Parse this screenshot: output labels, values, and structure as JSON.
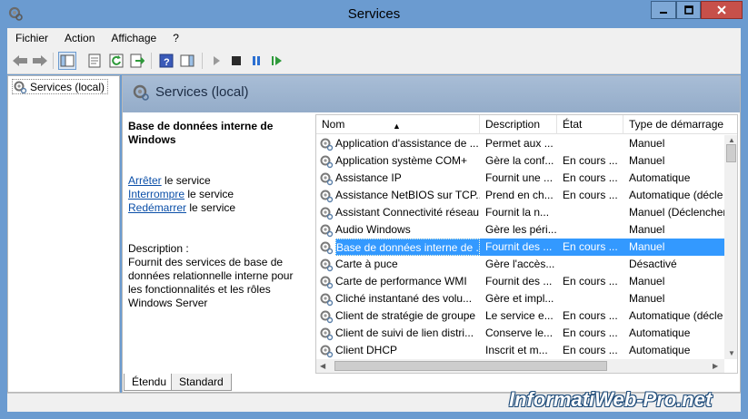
{
  "window": {
    "title": "Services"
  },
  "menu": [
    "Fichier",
    "Action",
    "Affichage",
    "?"
  ],
  "tree": {
    "root_label": "Services (local)"
  },
  "main": {
    "header_title": "Services (local)",
    "selected_service_title": "Base de données interne de Windows",
    "actions": [
      {
        "link": "Arrêter",
        "suffix": " le service"
      },
      {
        "link": "Interrompre",
        "suffix": " le service"
      },
      {
        "link": "Redémarrer",
        "suffix": " le service"
      }
    ],
    "description_label": "Description :",
    "description_text": "Fournit des services de base de données relationnelle interne pour les fonctionnalités et les rôles Windows Server"
  },
  "list": {
    "columns": [
      "Nom",
      "Description",
      "État",
      "Type de démarrage"
    ],
    "rows": [
      {
        "name": "Application d'assistance de ...",
        "desc": "Permet aux ...",
        "state": "",
        "startup": "Manuel"
      },
      {
        "name": "Application système COM+",
        "desc": "Gère la conf...",
        "state": "En cours ...",
        "startup": "Manuel"
      },
      {
        "name": "Assistance IP",
        "desc": "Fournit une ...",
        "state": "En cours ...",
        "startup": "Automatique"
      },
      {
        "name": "Assistance NetBIOS sur TCP...",
        "desc": "Prend en ch...",
        "state": "En cours ...",
        "startup": "Automatique (décle"
      },
      {
        "name": "Assistant Connectivité réseau",
        "desc": "Fournit la n...",
        "state": "",
        "startup": "Manuel (Déclencher"
      },
      {
        "name": "Audio Windows",
        "desc": "Gère les péri...",
        "state": "",
        "startup": "Manuel"
      },
      {
        "name": "Base de données interne de ...",
        "desc": "Fournit des ...",
        "state": "En cours ...",
        "startup": "Manuel",
        "selected": true
      },
      {
        "name": "Carte à puce",
        "desc": "Gère l'accès...",
        "state": "",
        "startup": "Désactivé"
      },
      {
        "name": "Carte de performance WMI",
        "desc": "Fournit des ...",
        "state": "En cours ...",
        "startup": "Manuel"
      },
      {
        "name": "Cliché instantané des volu...",
        "desc": "Gère et impl...",
        "state": "",
        "startup": "Manuel"
      },
      {
        "name": "Client de stratégie de groupe",
        "desc": "Le service e...",
        "state": "En cours ...",
        "startup": "Automatique (décle"
      },
      {
        "name": "Client de suivi de lien distri...",
        "desc": "Conserve le...",
        "state": "En cours ...",
        "startup": "Automatique"
      },
      {
        "name": "Client DHCP",
        "desc": "Inscrit et m...",
        "state": "En cours ...",
        "startup": "Automatique"
      }
    ]
  },
  "tabs": [
    "Étendu",
    "Standard"
  ],
  "watermark": "InformatiWeb-Pro.net",
  "colors": {
    "titlebar": "#6b9bd0",
    "selection": "#3399ff",
    "link": "#0b4fa8"
  }
}
